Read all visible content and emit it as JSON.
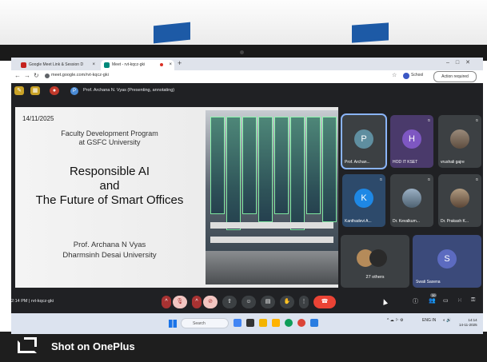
{
  "browser": {
    "tabs": [
      {
        "label": "Google Meet Link & Session D",
        "favicon_color": "#c5221f"
      },
      {
        "label": "Meet - rvt-kqcz-gki",
        "favicon_color": "#00897b"
      }
    ],
    "new_tab": "+",
    "url": "meet.google.com/rvt-kqcz-gki",
    "profile_label": "School",
    "action_button": "Action required"
  },
  "meet_top": {
    "presenter_initial": "P",
    "presenting_text": "Prof. Archana N. Vyas (Presenting, annotating)"
  },
  "slide": {
    "date": "14/11/2025",
    "program_line1": "Faculty Development Program",
    "program_line2": "at GSFC University",
    "title_line1": "Responsible AI",
    "title_line2": "and",
    "title_line3": "The Future of Smart Offices",
    "author_line1": "Prof. Archana N Vyas",
    "author_line2": "Dharmsinh Desai University"
  },
  "participants": [
    {
      "initial": "P",
      "name": "Prof. Archan...",
      "color": "#5f8ea0",
      "type": "avatar"
    },
    {
      "initial": "H",
      "name": "HOD IT KSET",
      "color": "#7e57c2",
      "type": "avatar"
    },
    {
      "initial": "",
      "name": "vrushali gajre",
      "color": "#8d6e63",
      "type": "photo"
    },
    {
      "initial": "K",
      "name": "Kanthadevi A...",
      "color": "#1e88e5",
      "type": "avatar"
    },
    {
      "initial": "",
      "name": "Dr. Kevalkum...",
      "color": "#607d8b",
      "type": "photo"
    },
    {
      "initial": "",
      "name": "Dr. Prakash K...",
      "color": "#795548",
      "type": "photo"
    }
  ],
  "others_label": "27 others",
  "swati": {
    "initial": "S",
    "name": "Swati Saxena"
  },
  "meet_bar": {
    "time_code": "2:14 PM | rvt-kqcz-gki",
    "participant_count": "30"
  },
  "taskbar": {
    "search_placeholder": "Search",
    "lang": "ENG IN",
    "time": "14:14",
    "date": "14-11-2025"
  },
  "watermark": "Shot on OnePlus",
  "colors": {
    "meet_bg": "#202124",
    "end_call": "#ea4335",
    "accent_blue": "#8ab4f8"
  }
}
